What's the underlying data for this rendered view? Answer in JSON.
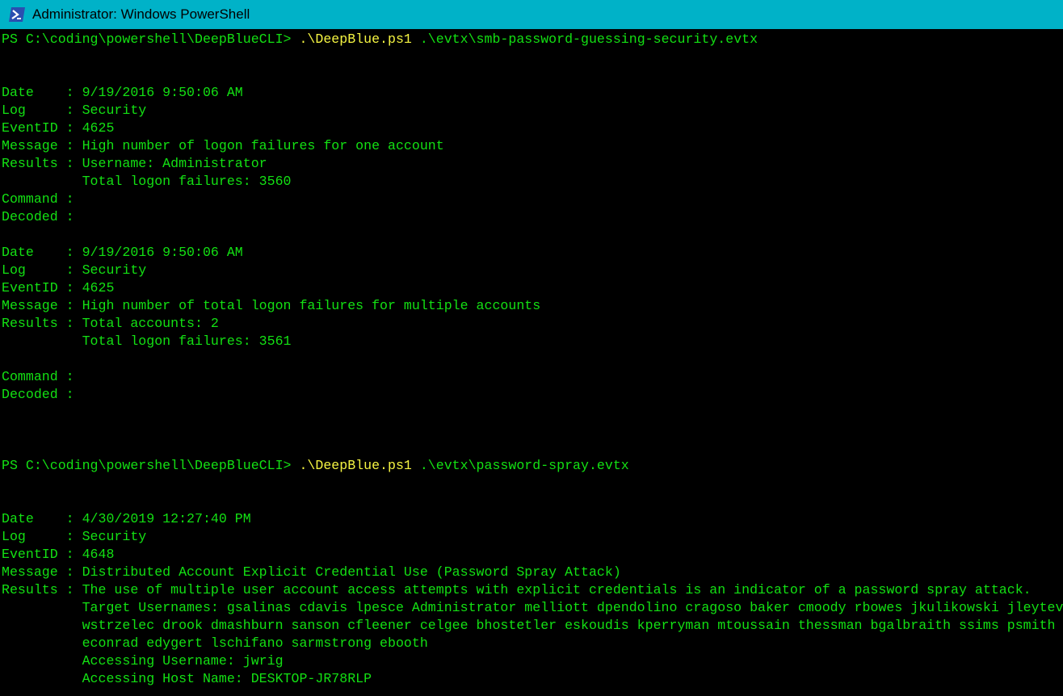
{
  "window": {
    "title": "Administrator: Windows PowerShell",
    "icon": "powershell-icon",
    "colors": {
      "titlebar": "#00b2c8",
      "background": "#000000",
      "text": "#13e013",
      "command": "#f5f542"
    }
  },
  "console": {
    "lines": [
      {
        "type": "prompt",
        "prompt": "PS C:\\coding\\powershell\\DeepBlueCLI> ",
        "cmd": ".\\DeepBlue.ps1",
        "args": " .\\evtx\\smb-password-guessing-security.evtx"
      },
      {
        "type": "blank"
      },
      {
        "type": "blank"
      },
      {
        "type": "field",
        "label": "Date    ",
        "value": "9/19/2016 9:50:06 AM"
      },
      {
        "type": "field",
        "label": "Log     ",
        "value": "Security"
      },
      {
        "type": "field",
        "label": "EventID ",
        "value": "4625"
      },
      {
        "type": "field",
        "label": "Message ",
        "value": "High number of logon failures for one account"
      },
      {
        "type": "field",
        "label": "Results ",
        "value": "Username: Administrator"
      },
      {
        "type": "cont",
        "value": "Total logon failures: 3560"
      },
      {
        "type": "field",
        "label": "Command ",
        "value": ""
      },
      {
        "type": "field",
        "label": "Decoded ",
        "value": ""
      },
      {
        "type": "blank"
      },
      {
        "type": "field",
        "label": "Date    ",
        "value": "9/19/2016 9:50:06 AM"
      },
      {
        "type": "field",
        "label": "Log     ",
        "value": "Security"
      },
      {
        "type": "field",
        "label": "EventID ",
        "value": "4625"
      },
      {
        "type": "field",
        "label": "Message ",
        "value": "High number of total logon failures for multiple accounts"
      },
      {
        "type": "field",
        "label": "Results ",
        "value": "Total accounts: 2"
      },
      {
        "type": "cont",
        "value": "Total logon failures: 3561"
      },
      {
        "type": "blank"
      },
      {
        "type": "field",
        "label": "Command ",
        "value": ""
      },
      {
        "type": "field",
        "label": "Decoded ",
        "value": ""
      },
      {
        "type": "blank"
      },
      {
        "type": "blank"
      },
      {
        "type": "blank"
      },
      {
        "type": "prompt",
        "prompt": "PS C:\\coding\\powershell\\DeepBlueCLI> ",
        "cmd": ".\\DeepBlue.ps1",
        "args": " .\\evtx\\password-spray.evtx"
      },
      {
        "type": "blank"
      },
      {
        "type": "blank"
      },
      {
        "type": "field",
        "label": "Date    ",
        "value": "4/30/2019 12:27:40 PM"
      },
      {
        "type": "field",
        "label": "Log     ",
        "value": "Security"
      },
      {
        "type": "field",
        "label": "EventID ",
        "value": "4648"
      },
      {
        "type": "field",
        "label": "Message ",
        "value": "Distributed Account Explicit Credential Use (Password Spray Attack)"
      },
      {
        "type": "field",
        "label": "Results ",
        "value": "The use of multiple user account access attempts with explicit credentials is an indicator of a password spray attack."
      },
      {
        "type": "cont",
        "value": "Target Usernames: gsalinas cdavis lpesce Administrator melliott dpendolino cragoso baker cmoody rbowes jkulikowski jleytevidal"
      },
      {
        "type": "cont",
        "value": "wstrzelec drook dmashburn sanson cfleener celgee bhostetler eskoudis kperryman mtoussain thessman bgalbraith ssims psmith jorchilla"
      },
      {
        "type": "cont",
        "value": "econrad edygert lschifano sarmstrong ebooth"
      },
      {
        "type": "cont",
        "value": "Accessing Username: jwrig"
      },
      {
        "type": "cont",
        "value": "Accessing Host Name: DESKTOP-JR78RLP"
      }
    ]
  }
}
